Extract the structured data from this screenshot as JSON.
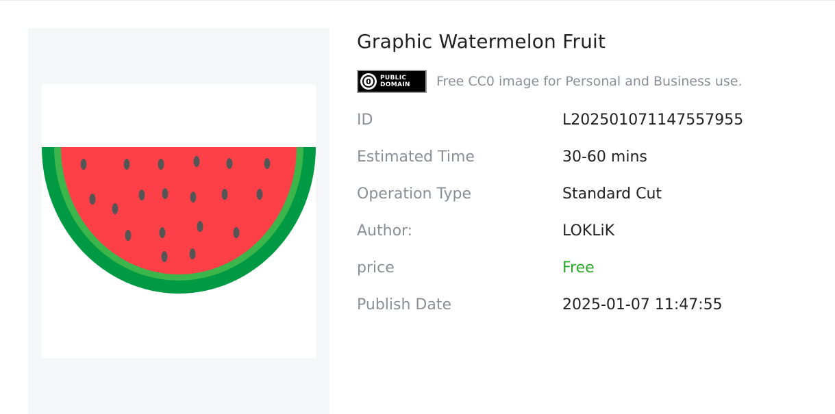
{
  "product": {
    "title": "Graphic Watermelon Fruit",
    "image_subject": "watermelon-slice"
  },
  "license": {
    "badge_line1": "PUBLIC",
    "badge_line2": "DOMAIN",
    "badge_symbol": "0",
    "text": "Free CC0 image for Personal and Business use."
  },
  "meta": {
    "id_label": "ID",
    "id_value": "L202501071147557955",
    "time_label": "Estimated Time",
    "time_value": "30-60 mins",
    "operation_label": "Operation Type",
    "operation_value": "Standard Cut",
    "author_label": "Author:",
    "author_value": "LOKLiK",
    "price_label": "price",
    "price_value": "Free",
    "date_label": "Publish Date",
    "date_value": "2025-01-07 11:47:55"
  },
  "colors": {
    "rind_dark": "#009a44",
    "rind_light": "#3cb54a",
    "flesh": "#fd4048",
    "seed": "#555555",
    "price_free": "#2aab2a",
    "label_gray": "#8a8f96",
    "panel_bg": "#f5f6f8"
  }
}
